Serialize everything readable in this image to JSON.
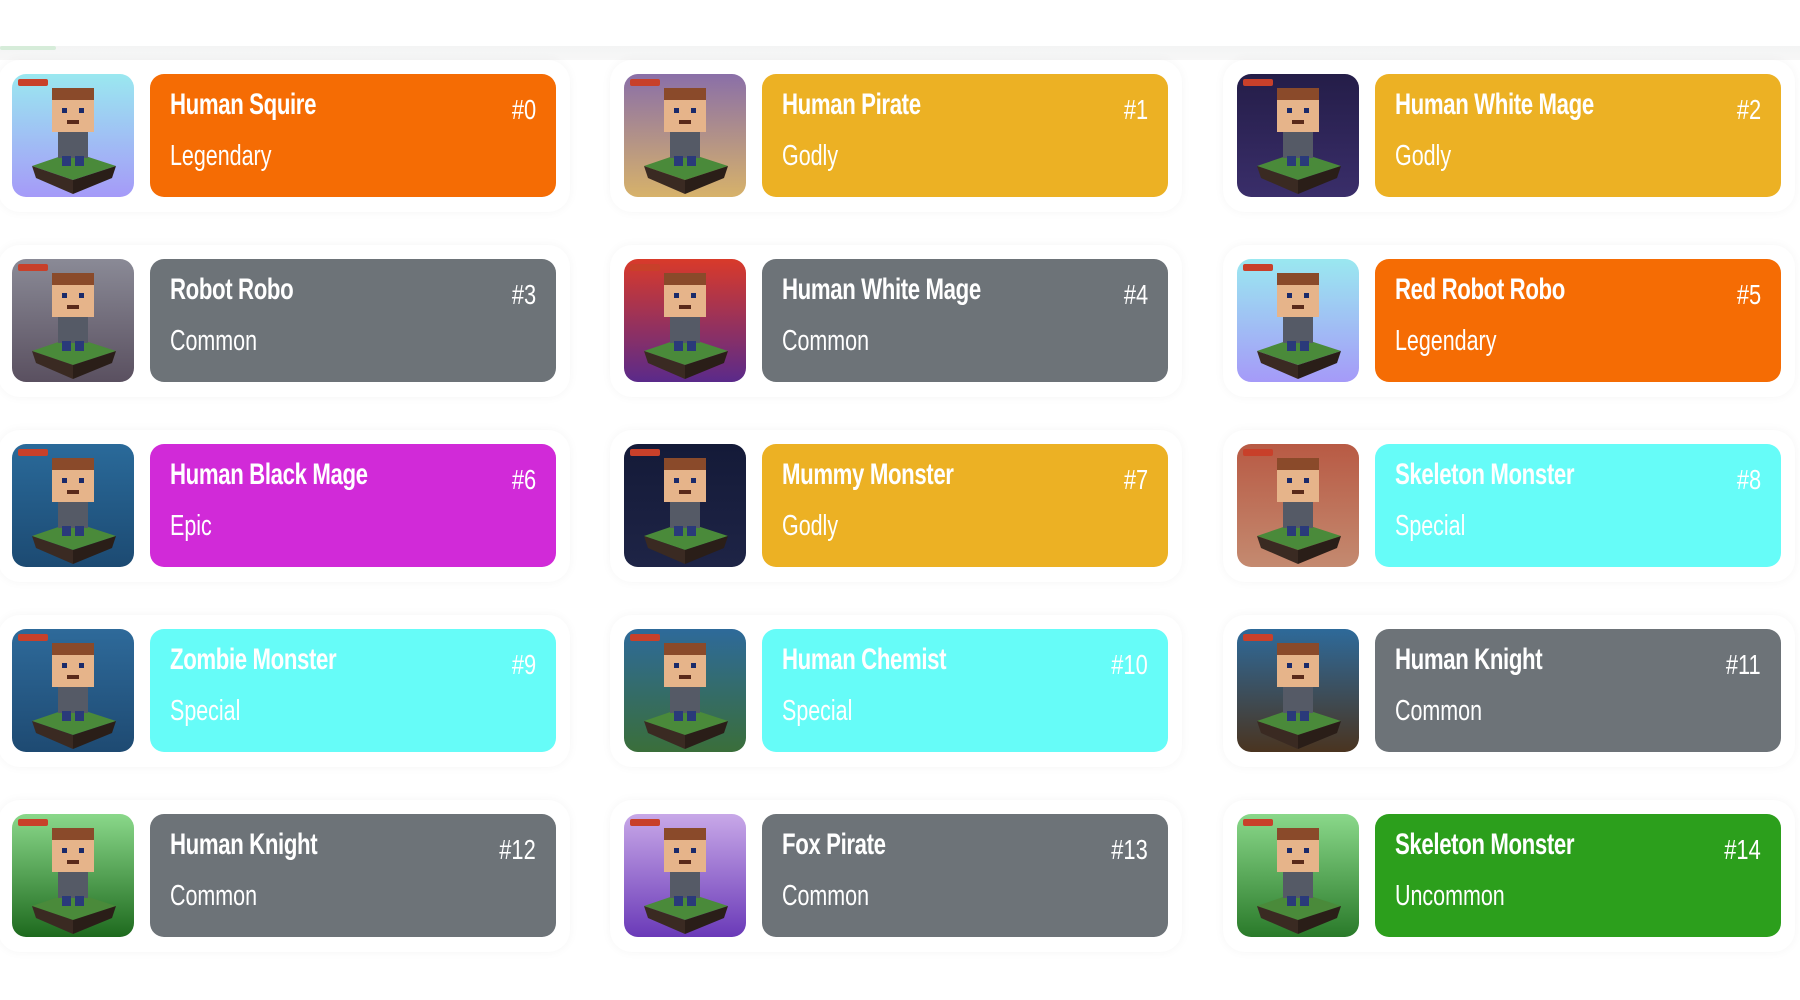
{
  "rarity_colors": {
    "Legendary": "#f56c04",
    "Godly": "#ecb124",
    "Common": "#6d7378",
    "Epic": "#d12ad8",
    "Special": "#66fcf8",
    "Uncommon": "#2c9f1c"
  },
  "characters": [
    {
      "name": "Human Squire",
      "number": "#0",
      "rarity": "Legendary",
      "thumb": {
        "bg_top": "#9ae8f0",
        "bg_bottom": "#a59af8",
        "icon": "squire-portrait-icon"
      }
    },
    {
      "name": "Human Pirate",
      "number": "#1",
      "rarity": "Godly",
      "thumb": {
        "bg_top": "#8a6fa8",
        "bg_bottom": "#d7b26a",
        "icon": "pirate-portrait-icon"
      }
    },
    {
      "name": "Human White Mage",
      "number": "#2",
      "rarity": "Godly",
      "thumb": {
        "bg_top": "#241d48",
        "bg_bottom": "#3a2e6a",
        "icon": "white-mage-portrait-icon"
      }
    },
    {
      "name": "Robot Robo",
      "number": "#3",
      "rarity": "Common",
      "thumb": {
        "bg_top": "#8a8a96",
        "bg_bottom": "#5a5060",
        "icon": "robot-portrait-icon"
      }
    },
    {
      "name": "Human White Mage",
      "number": "#4",
      "rarity": "Common",
      "thumb": {
        "bg_top": "#d93a2a",
        "bg_bottom": "#5a2a8a",
        "icon": "white-mage-portrait-icon"
      }
    },
    {
      "name": "Red Robot Robo",
      "number": "#5",
      "rarity": "Legendary",
      "thumb": {
        "bg_top": "#9ae8f0",
        "bg_bottom": "#a59af8",
        "icon": "red-robot-portrait-icon"
      }
    },
    {
      "name": "Human Black Mage",
      "number": "#6",
      "rarity": "Epic",
      "thumb": {
        "bg_top": "#2a6a9a",
        "bg_bottom": "#1c4a72",
        "icon": "black-mage-portrait-icon"
      }
    },
    {
      "name": "Mummy Monster",
      "number": "#7",
      "rarity": "Godly",
      "thumb": {
        "bg_top": "#141a38",
        "bg_bottom": "#1e2446",
        "icon": "mummy-portrait-icon"
      }
    },
    {
      "name": "Skeleton Monster",
      "number": "#8",
      "rarity": "Special",
      "thumb": {
        "bg_top": "#b85a44",
        "bg_bottom": "#c48a70",
        "icon": "skeleton-portrait-icon"
      }
    },
    {
      "name": "Zombie Monster",
      "number": "#9",
      "rarity": "Special",
      "thumb": {
        "bg_top": "#2e6a9a",
        "bg_bottom": "#1e4a72",
        "icon": "zombie-portrait-icon"
      }
    },
    {
      "name": "Human Chemist",
      "number": "#10",
      "rarity": "Special",
      "thumb": {
        "bg_top": "#2e6a9a",
        "bg_bottom": "#3a6e3a",
        "icon": "chemist-portrait-icon"
      }
    },
    {
      "name": "Human Knight",
      "number": "#11",
      "rarity": "Common",
      "thumb": {
        "bg_top": "#2e6a9a",
        "bg_bottom": "#4a3420",
        "icon": "knight-portrait-icon"
      }
    },
    {
      "name": "Human Knight",
      "number": "#12",
      "rarity": "Common",
      "thumb": {
        "bg_top": "#8ad88a",
        "bg_bottom": "#1e6a1e",
        "icon": "knight-portrait-icon"
      }
    },
    {
      "name": "Fox Pirate",
      "number": "#13",
      "rarity": "Common",
      "thumb": {
        "bg_top": "#c8a8e8",
        "bg_bottom": "#6a3ab8",
        "icon": "fox-pirate-portrait-icon"
      }
    },
    {
      "name": "Skeleton Monster",
      "number": "#14",
      "rarity": "Uncommon",
      "thumb": {
        "bg_top": "#8ad88a",
        "bg_bottom": "#2a7a2a",
        "icon": "skeleton-portrait-icon"
      }
    }
  ]
}
